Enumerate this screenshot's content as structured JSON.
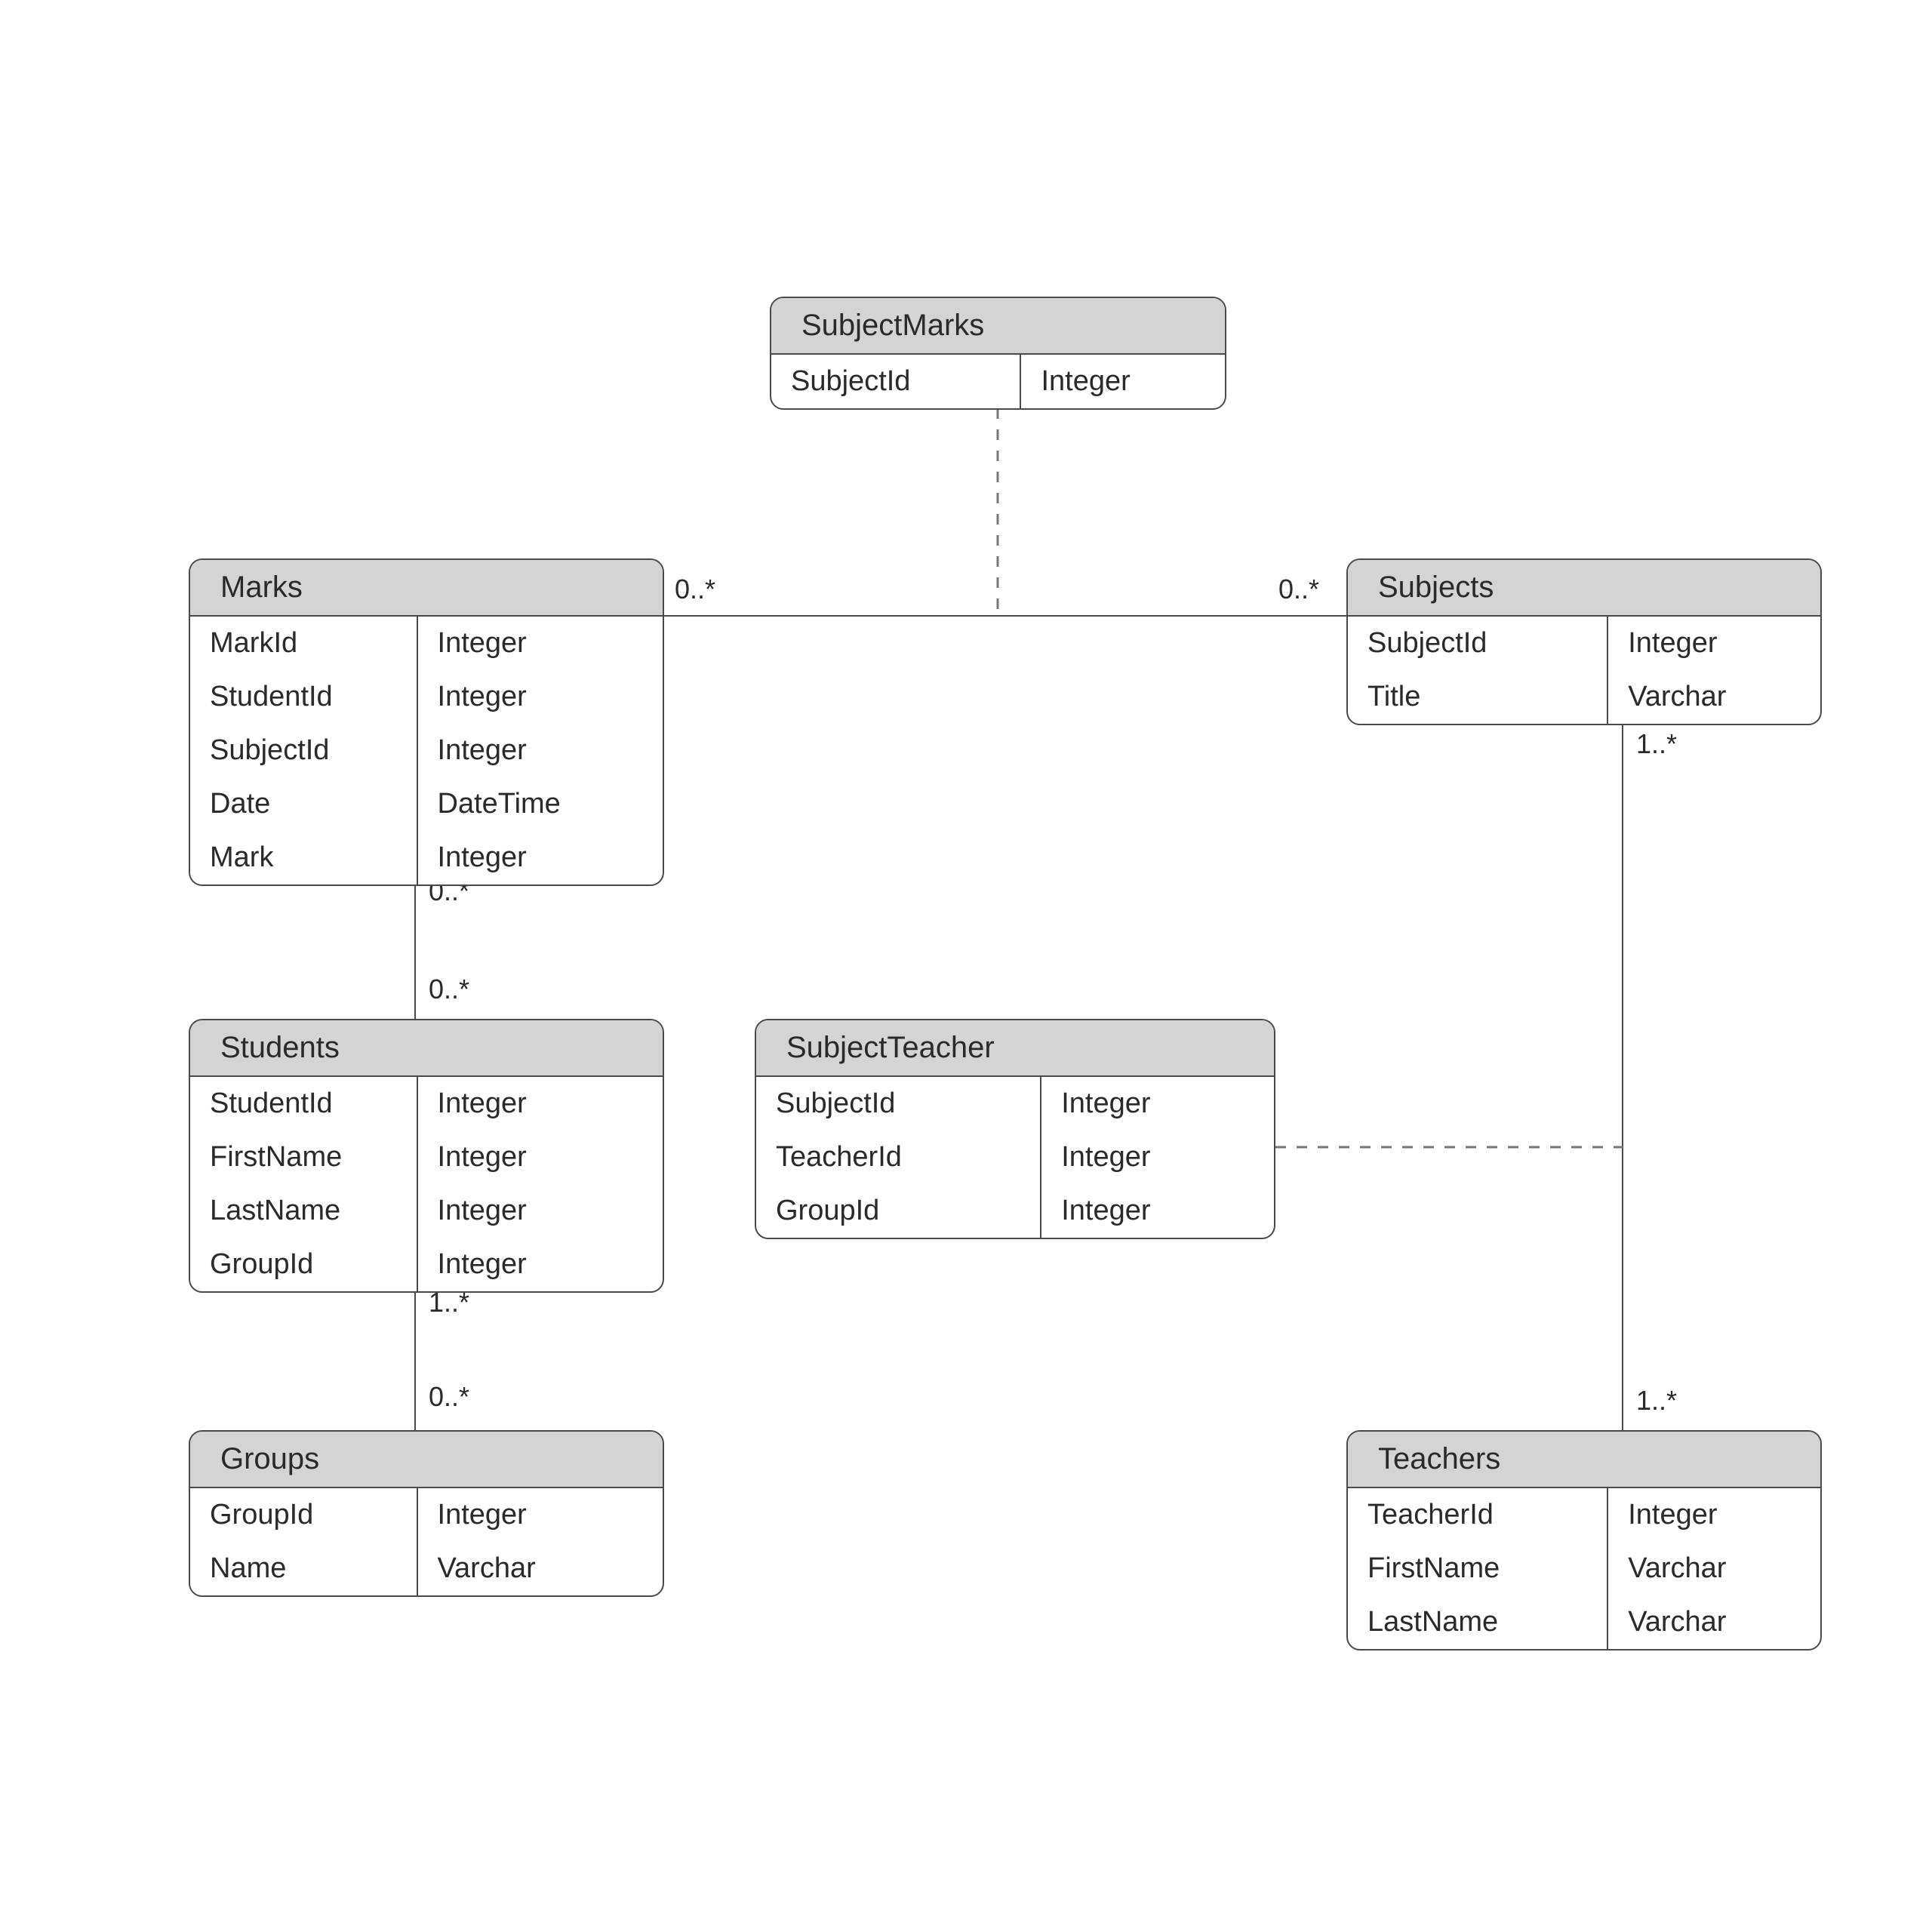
{
  "entities": {
    "subjectMarks": {
      "title": "SubjectMarks",
      "rows": [
        {
          "name": "SubjectId",
          "type": "Integer"
        }
      ]
    },
    "marks": {
      "title": "Marks",
      "rows": [
        {
          "name": "MarkId",
          "type": "Integer"
        },
        {
          "name": "StudentId",
          "type": "Integer"
        },
        {
          "name": "SubjectId",
          "type": "Integer"
        },
        {
          "name": "Date",
          "type": "DateTime"
        },
        {
          "name": "Mark",
          "type": "Integer"
        }
      ]
    },
    "subjects": {
      "title": "Subjects",
      "rows": [
        {
          "name": "SubjectId",
          "type": "Integer"
        },
        {
          "name": "Title",
          "type": "Varchar"
        }
      ]
    },
    "students": {
      "title": "Students",
      "rows": [
        {
          "name": "StudentId",
          "type": "Integer"
        },
        {
          "name": "FirstName",
          "type": "Integer"
        },
        {
          "name": "LastName",
          "type": "Integer"
        },
        {
          "name": "GroupId",
          "type": "Integer"
        }
      ]
    },
    "subjectTeacher": {
      "title": "SubjectTeacher",
      "rows": [
        {
          "name": "SubjectId",
          "type": "Integer"
        },
        {
          "name": "TeacherId",
          "type": "Integer"
        },
        {
          "name": "GroupId",
          "type": "Integer"
        }
      ]
    },
    "groups": {
      "title": "Groups",
      "rows": [
        {
          "name": "GroupId",
          "type": "Integer"
        },
        {
          "name": "Name",
          "type": "Varchar"
        }
      ]
    },
    "teachers": {
      "title": "Teachers",
      "rows": [
        {
          "name": "TeacherId",
          "type": "Integer"
        },
        {
          "name": "FirstName",
          "type": "Varchar"
        },
        {
          "name": "LastName",
          "type": "Varchar"
        }
      ]
    }
  },
  "multiplicities": {
    "marks_subjects_left": "0..*",
    "marks_subjects_right": "0..*",
    "marks_students_top": "0..*",
    "marks_students_bottom": "0..*",
    "students_groups_top": "1..*",
    "students_groups_bottom": "0..*",
    "subjects_teachers_top": "1..*",
    "subjects_teachers_bottom": "1..*"
  }
}
